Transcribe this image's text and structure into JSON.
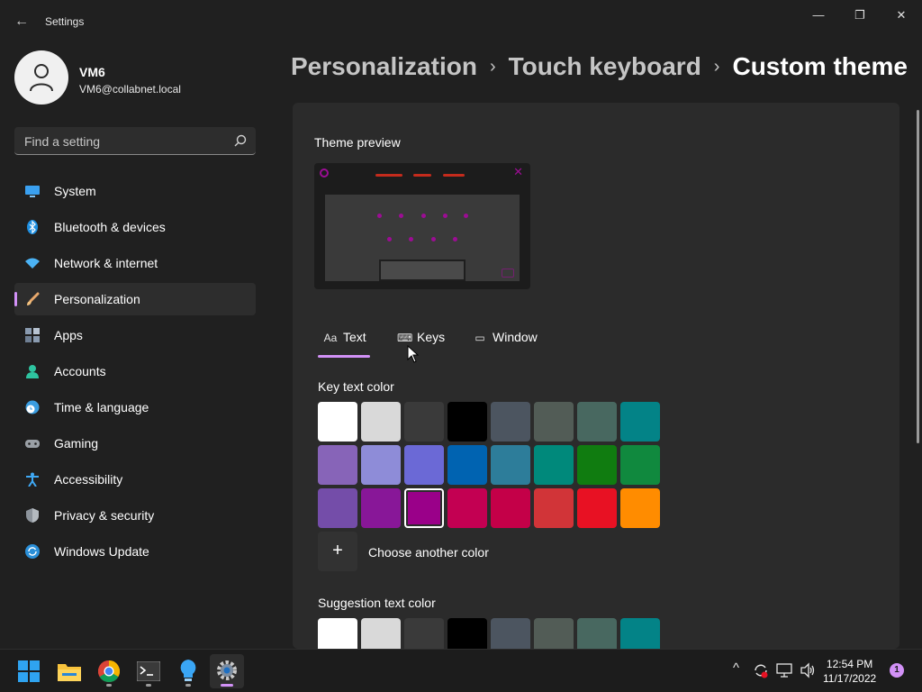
{
  "window": {
    "title": "Settings",
    "back_glyph": "←",
    "min_glyph": "—",
    "max_glyph": "❐",
    "close_glyph": "✕"
  },
  "user": {
    "name": "VM6",
    "email": "VM6@collabnet.local"
  },
  "search": {
    "placeholder": "Find a setting",
    "icon": "search-icon"
  },
  "sidebar": {
    "items": [
      {
        "label": "System",
        "icon": "monitor-icon",
        "color": "#3aa0f0"
      },
      {
        "label": "Bluetooth & devices",
        "icon": "bluetooth-icon",
        "color": "#1e8fe1"
      },
      {
        "label": "Network & internet",
        "icon": "wifi-icon",
        "color": "#4bb3f5"
      },
      {
        "label": "Personalization",
        "icon": "brush-icon",
        "color": "#e8a86b",
        "active": true
      },
      {
        "label": "Apps",
        "icon": "apps-icon",
        "color": "#8a9bb0"
      },
      {
        "label": "Accounts",
        "icon": "person-icon",
        "color": "#2ec4a0"
      },
      {
        "label": "Time & language",
        "icon": "clock-globe-icon",
        "color": "#3a9de0"
      },
      {
        "label": "Gaming",
        "icon": "gamepad-icon",
        "color": "#9aa0a6"
      },
      {
        "label": "Accessibility",
        "icon": "accessibility-icon",
        "color": "#3fa9f5"
      },
      {
        "label": "Privacy & security",
        "icon": "shield-icon",
        "color": "#8d949c"
      },
      {
        "label": "Windows Update",
        "icon": "update-icon",
        "color": "#2a8fd8"
      }
    ]
  },
  "breadcrumb": {
    "part1": "Personalization",
    "sep": "›",
    "part2": "Touch keyboard",
    "current": "Custom theme"
  },
  "content": {
    "preview_label": "Theme preview",
    "tabs": [
      {
        "label": "Text",
        "icon_text": "Aa"
      },
      {
        "label": "Keys",
        "icon_text": "⌨"
      },
      {
        "label": "Window",
        "icon_text": "▭"
      }
    ],
    "key_text_color_label": "Key text color",
    "suggestion_text_color_label": "Suggestion text color",
    "choose_label": "Choose another color",
    "plus_glyph": "+",
    "swatch_colors": [
      [
        "#ffffff",
        "#d9d9d9",
        "#3a3a3a",
        "#000000",
        "#4c5560",
        "#525c56",
        "#486860",
        "#038387"
      ],
      [
        "#8764b8",
        "#8e8cd8",
        "#6b69d6",
        "#0063b1",
        "#2d7d9a",
        "#00897b",
        "#107c10",
        "#10893e"
      ],
      [
        "#744da9",
        "#881798",
        "#9a0089",
        "#c30052",
        "#c40048",
        "#d13438",
        "#e81123",
        "#ff8c00"
      ]
    ],
    "selected_swatch": "#9a0089",
    "suggestion_colors": [
      "#ffffff",
      "#d9d9d9",
      "#3a3a3a",
      "#000000",
      "#4c5560",
      "#525c56",
      "#486860",
      "#038387"
    ]
  },
  "taskbar": {
    "apps": [
      "windows-start-icon",
      "file-explorer-icon",
      "chrome-icon",
      "terminal-icon",
      "tips-icon",
      "settings-icon"
    ],
    "time": "12:54 PM",
    "date": "11/17/2022",
    "notifications": "1",
    "tray": {
      "chevron": "^",
      "volume": "🔊"
    }
  },
  "colors": {
    "accent": "#d291f7",
    "background": "#202020",
    "card": "#2b2b2b"
  }
}
